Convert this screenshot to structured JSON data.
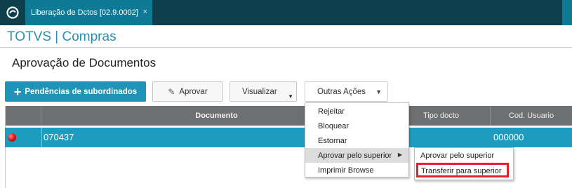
{
  "tab": {
    "title": "Liberação de Dctos [02.9.0002]",
    "close_glyph": "×"
  },
  "header": {
    "app_title": "TOTVS | Compras",
    "page_title": "Aprovação de Documentos"
  },
  "toolbar": {
    "pendencias_label": "Pendências de subordinados",
    "aprovar_label": "Aprovar",
    "visualizar_label": "Visualizar",
    "outras_label": "Outras Ações"
  },
  "grid": {
    "columns": [
      "",
      "Documento",
      "Tipo docto",
      "Cod. Usuario"
    ],
    "rows": [
      {
        "status": "red",
        "documento": "070437",
        "usuario": "000000"
      }
    ]
  },
  "menu": {
    "items": [
      "Rejeitar",
      "Bloquear",
      "Estornar",
      "Aprovar pelo superior",
      "Imprimir Browse"
    ]
  },
  "submenu": {
    "items": [
      "Aprovar pelo superior",
      "Transferir para superior"
    ]
  },
  "colors": {
    "accent": "#1e95b7",
    "topbar": "#0e3f4c",
    "highlight": "#e8202a",
    "status_red": "#e11d1d"
  },
  "icons": [
    "totvs-logo-icon",
    "plus-icon",
    "pencil-icon",
    "caret-down-icon",
    "caret-right-icon",
    "status-red-icon"
  ]
}
